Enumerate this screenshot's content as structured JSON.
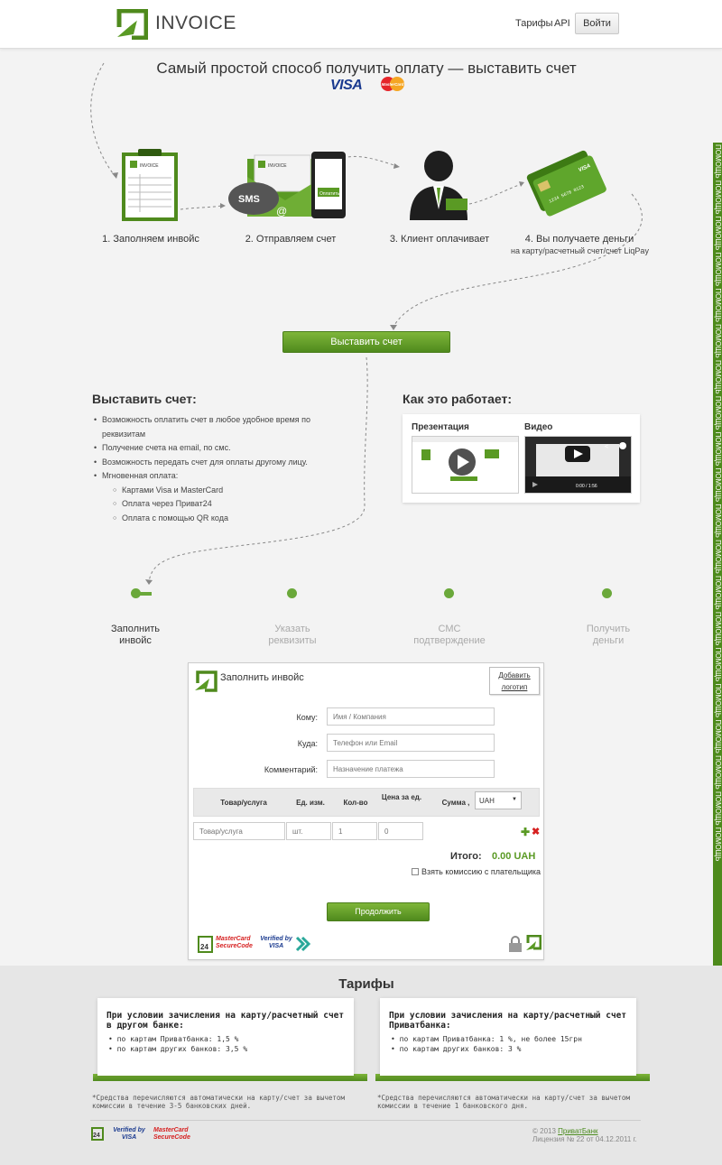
{
  "header": {
    "logo_text": "INVOICE",
    "nav_tariffs": "Тарифы",
    "nav_api": "API",
    "login": "Войти"
  },
  "hero": {
    "title": "Самый простой способ получить оплату — выставить счет",
    "visa": "VISA",
    "mastercard": "MasterCard"
  },
  "steps": [
    {
      "label": "1. Заполняем инвойс"
    },
    {
      "label": "2. Отправляем счет",
      "sms": "SMS",
      "pay_button": "Оплатить"
    },
    {
      "label": "3. Клиент оплачивает"
    },
    {
      "label": "4. Вы получаете деньги",
      "sub": "на карту/расчетный счет/счет LiqPay"
    }
  ],
  "cta": "Выставить счет",
  "features": {
    "title": "Выставить счет:",
    "items": [
      "Возможность оплатить счет в любое удобное время по реквизитам",
      "Получение счета на email, по смс.",
      "Возможность передать счет для оплаты другому лицу.",
      "Мгновенная оплата:"
    ],
    "sub_items": [
      "Картами Visa и MasterCard",
      "Оплата через Приват24",
      "Оплата с помощью QR кода"
    ]
  },
  "how": {
    "title": "Как это работает:",
    "presentation": "Презентация",
    "video": "Видео",
    "video_time": "0:00 / 1:56"
  },
  "progress": [
    {
      "label": "Заполнить инвойс",
      "active": true
    },
    {
      "label": "Указать реквизиты",
      "active": false
    },
    {
      "label": "СМС подтверждение",
      "active": false
    },
    {
      "label": "Получить деньги",
      "active": false
    }
  ],
  "form": {
    "title": "Заполнить инвойс",
    "add_logo": "Добавить логотип",
    "to_label": "Кому:",
    "to_placeholder": "Имя / Компания",
    "where_label": "Куда:",
    "where_placeholder": "Телефон или Email",
    "comment_label": "Комментарий:",
    "comment_placeholder": "Назначение платежа",
    "col_product": "Товар/услуга",
    "col_unit": "Ед. изм.",
    "col_qty": "Кол-во",
    "col_price": "Цена за ед.",
    "col_sum": "Сумма ,",
    "currency": "UAH",
    "row_product_placeholder": "Товар/услуга",
    "row_unit_placeholder": "шт.",
    "row_qty_placeholder": "1",
    "row_price_placeholder": "0",
    "total_label": "Итого:",
    "total_value": "0.00 UAH",
    "commission": "Взять комиссию с плательщика",
    "submit": "Продолжить",
    "badge_24": "24",
    "badge_mc": "MasterCard SecureCode",
    "badge_visa": "Verified by VISA"
  },
  "tariffs": {
    "title": "Тарифы",
    "cards": [
      {
        "heading": "При условии зачисления на карту/расчетный счет в другом банке:",
        "items": [
          "по картам Приватбанка: 1,5 %",
          "по картам других банков: 3,5 %"
        ],
        "note": "*Средства перечисляются автоматически на карту/счет за вычетом комиссии в течение 3-5 банковских дней."
      },
      {
        "heading": "При условии зачисления на карту/расчетный счет Приватбанка:",
        "items": [
          "по картам Приватбанка: 1 %, не более 15грн",
          "по картам других банков: 3 %"
        ],
        "note": "*Средства перечисляются автоматически на карту/счет за вычетом комиссии в течение 1 банковского дня."
      }
    ]
  },
  "footer": {
    "copyright_prefix": "© 2013 ",
    "bank_link": "ПриватБанк",
    "license": "Лицензия № 22 от 04.12.2011 г.",
    "badge_24": "24",
    "badge_visa": "Verified by VISA",
    "badge_mc": "MasterCard SecureCode"
  },
  "side_tab": "ПОМОЩЬ ПОМОЩЬ ПОМОЩЬ ПОМОЩЬ ПОМОЩЬ ПОМОЩЬ ПОМОЩЬ ПОМОЩЬ ПОМОЩЬ ПОМОЩЬ ПОМОЩЬ ПОМОЩЬ ПОМОЩЬ ПОМОЩЬ ПОМОЩЬ ПОМОЩЬ ПОМОЩЬ ПОМОЩЬ ПОМОЩЬ ПОМОЩЬ",
  "colors": {
    "brand_green": "#5a9a24",
    "button_green_top": "#7fb63a",
    "button_green_bottom": "#4f8a1d",
    "visa_blue": "#1a3a8f",
    "mc_red": "#e5252a"
  }
}
